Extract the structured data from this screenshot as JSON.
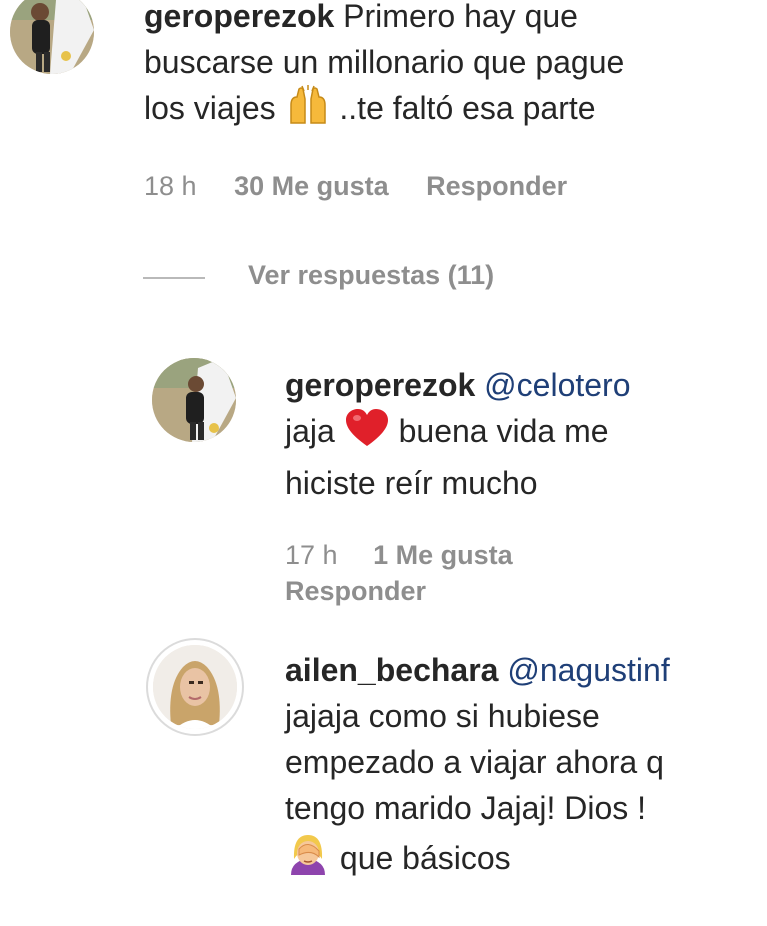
{
  "comments": [
    {
      "username": "geroperezok",
      "text_line1": "Primero hay que",
      "text_line2": "buscarse un millonario que pague",
      "text_line3a": "los viajes",
      "text_line3_emoji": "raising-hands-emoji",
      "text_line3b": "..te faltó esa parte",
      "time": "18 h",
      "likes": "30 Me gusta",
      "reply_label": "Responder"
    },
    {
      "username": "geroperezok",
      "mention": "@celotero",
      "text_line1a": "jaja",
      "text_line1_emoji": "red-heart-emoji",
      "text_line1b": "buena vida me",
      "text_line2": "hiciste reír mucho",
      "time": "17 h",
      "likes": "1 Me gusta",
      "reply_label": "Responder"
    },
    {
      "username": "ailen_bechara",
      "mention": "@nagustinf",
      "text_line1": "jajaja como si hubiese",
      "text_line2": "empezado a viajar ahora q",
      "text_line3": "tengo marido Jajaj! Dios !",
      "text_line4_emoji": "woman-facepalming-emoji",
      "text_line4": "que básicos"
    }
  ],
  "replies_toggle": "Ver respuestas (11)",
  "colors": {
    "text": "#262626",
    "muted": "#8e8e8e",
    "mention": "#1f3f77",
    "heart": "#e0202a"
  }
}
